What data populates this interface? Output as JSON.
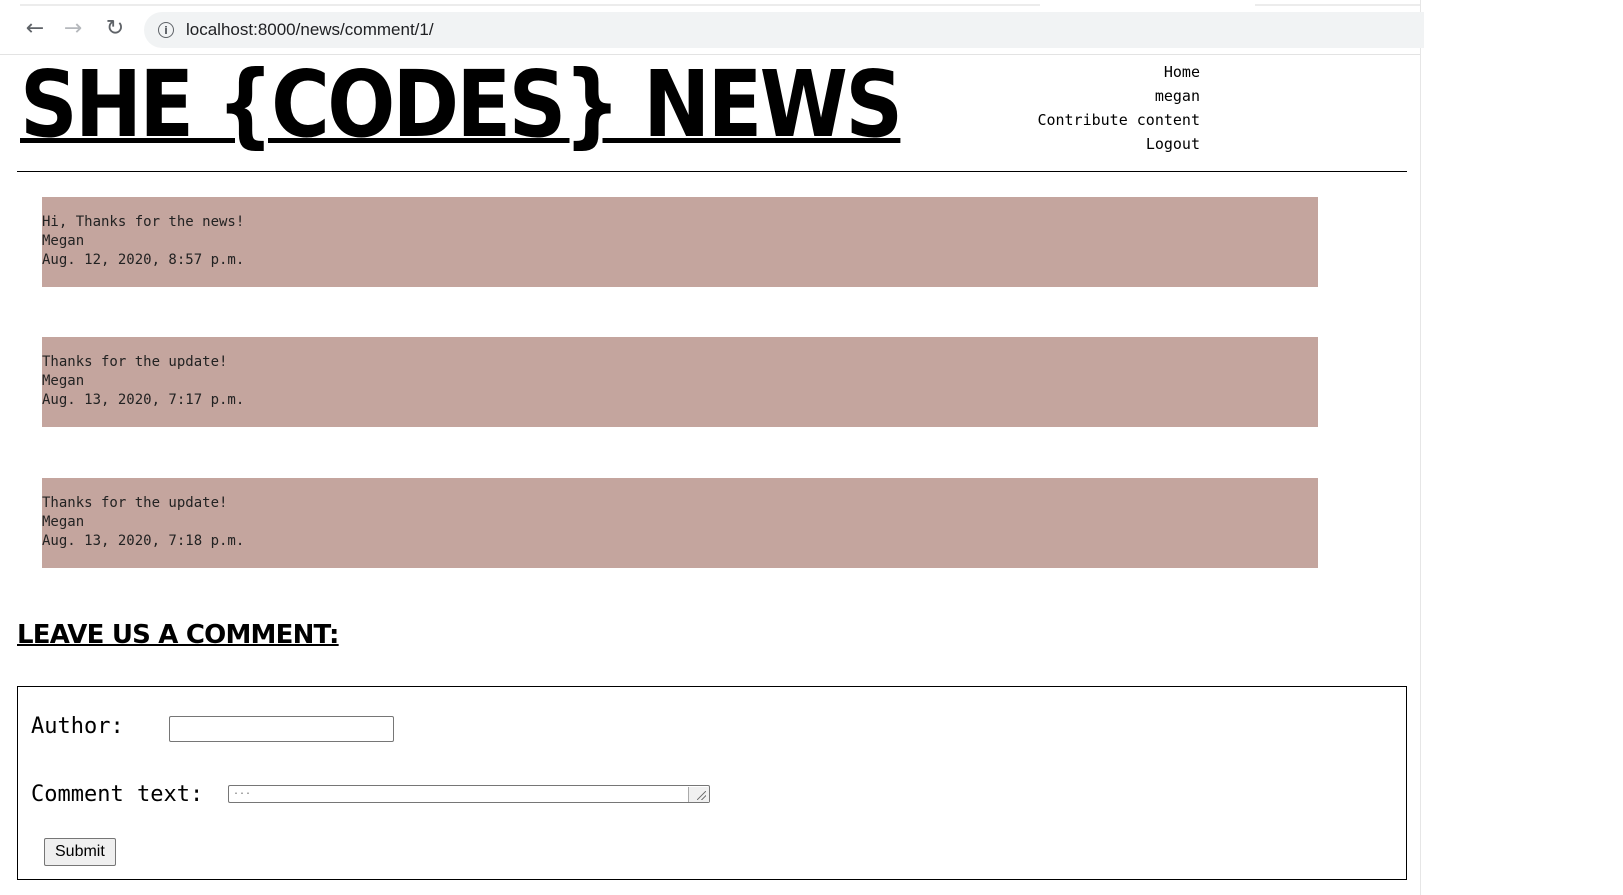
{
  "browser": {
    "url": "localhost:8000/news/comment/1/"
  },
  "header": {
    "site_title": "SHE {CODES} NEWS",
    "nav": [
      "Home",
      "megan",
      "Contribute content",
      "Logout"
    ]
  },
  "comments": [
    {
      "text": "Hi, Thanks for the news!",
      "author": "Megan",
      "date": "Aug. 12, 2020, 8:57 p.m."
    },
    {
      "text": "Thanks for the update!",
      "author": "Megan",
      "date": "Aug. 13, 2020, 7:17 p.m."
    },
    {
      "text": "Thanks for the update!",
      "author": "Megan",
      "date": "Aug. 13, 2020, 7:18 p.m."
    }
  ],
  "form": {
    "heading": "LEAVE US A COMMENT:",
    "author_label": "Author:",
    "author_value": "",
    "comment_label": "Comment text:",
    "comment_placeholder": "...",
    "submit_label": "Submit"
  },
  "colors": {
    "comment_bg": "#c4a59e",
    "text": "#000000"
  }
}
